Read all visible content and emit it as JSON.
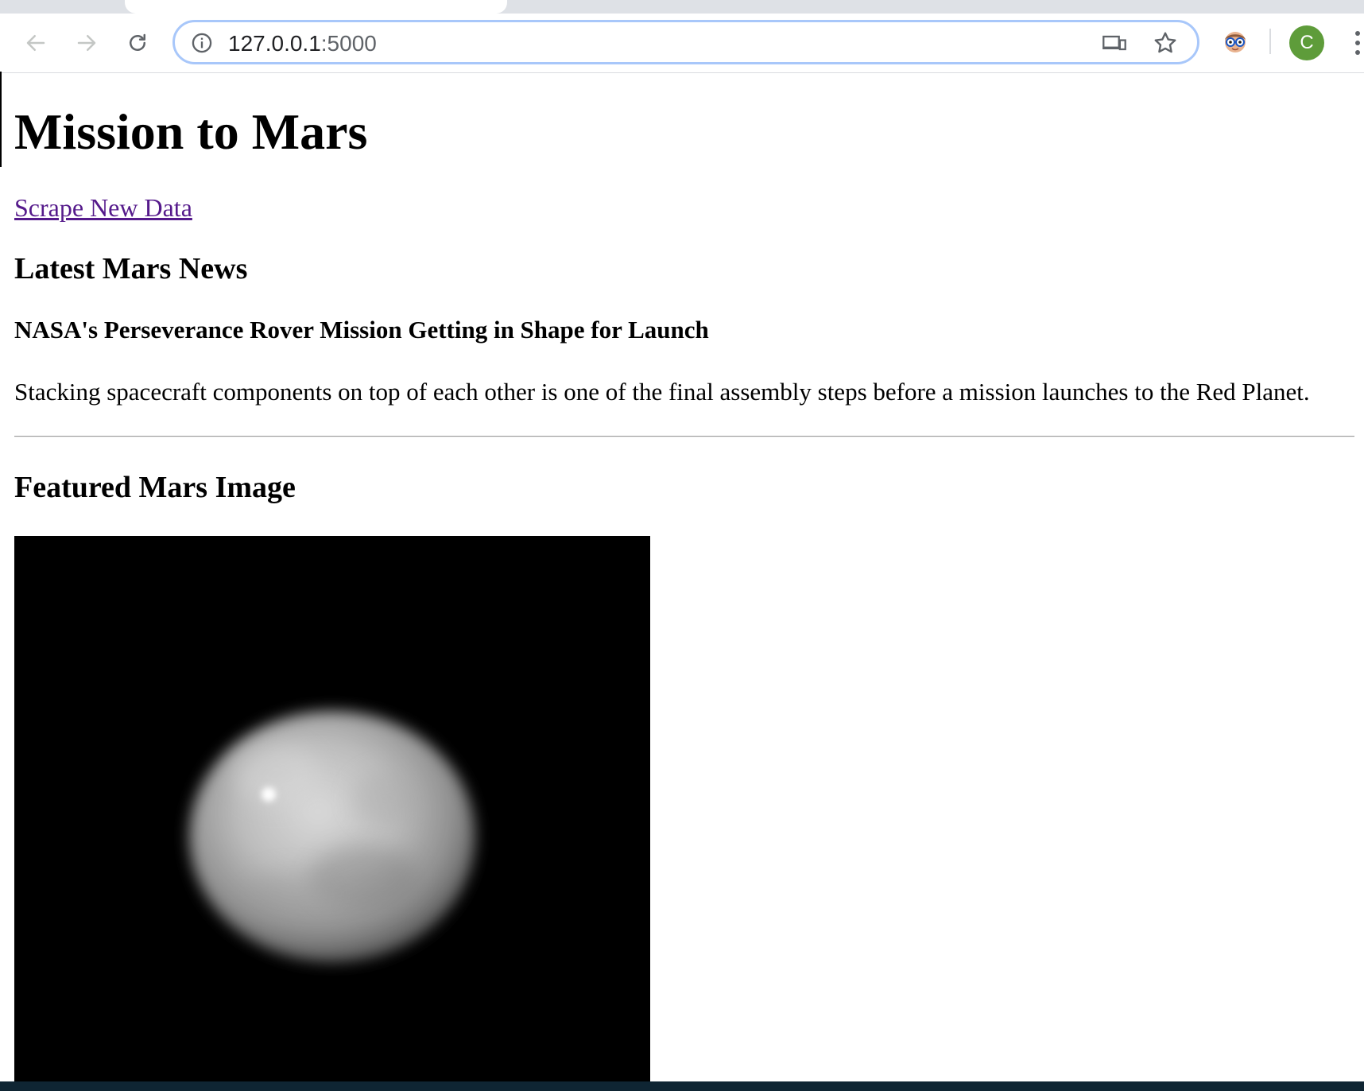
{
  "browser": {
    "url_host": "127.0.0.1",
    "url_port": ":5000",
    "profile_initial": "C",
    "icons": {
      "back": "back-arrow-icon",
      "forward": "forward-arrow-icon",
      "reload": "reload-icon",
      "site_info": "info-icon",
      "cast": "cast-icon",
      "bookmark": "star-icon",
      "extension": "glasses-face-icon",
      "menu": "three-dots-menu-icon"
    },
    "colors": {
      "omnibox_focus": "#a8c7fa",
      "avatar": "#5e9c3a",
      "tabstrip": "#dee1e6"
    }
  },
  "page": {
    "title": "Mission to Mars",
    "scrape_link": "Scrape New Data",
    "news_heading": "Latest Mars News",
    "news_title": "NASA's Perseverance Rover Mission Getting in Shape for Launch",
    "news_paragraph": "Stacking spacecraft components on top of each other is one of the final assembly steps before a mission launches to the Red Planet.",
    "featured_heading": "Featured Mars Image",
    "link_color": "#551a8b"
  }
}
